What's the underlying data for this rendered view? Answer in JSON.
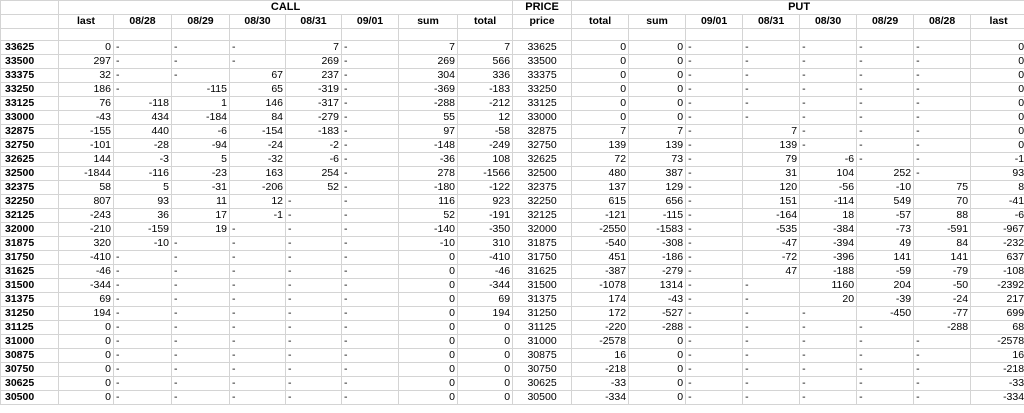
{
  "sections": {
    "call": "CALL",
    "price": "PRICE",
    "put": "PUT"
  },
  "call_headers": [
    "last",
    "08/28",
    "08/29",
    "08/30",
    "08/31",
    "09/01",
    "sum",
    "total"
  ],
  "price_header": "price",
  "put_headers": [
    "total",
    "sum",
    "09/01",
    "08/31",
    "08/30",
    "08/29",
    "08/28",
    "last"
  ],
  "rows": [
    {
      "strike": "33625",
      "call": [
        "0",
        "-",
        "-",
        "-",
        "7",
        "-",
        "7",
        "7"
      ],
      "price": "33625",
      "put": [
        "0",
        "0",
        "-",
        "-",
        "-",
        "-",
        "-",
        "0"
      ]
    },
    {
      "strike": "33500",
      "call": [
        "297",
        "-",
        "-",
        "-",
        "269",
        "-",
        "269",
        "566"
      ],
      "price": "33500",
      "put": [
        "0",
        "0",
        "-",
        "-",
        "-",
        "-",
        "-",
        "0"
      ]
    },
    {
      "strike": "33375",
      "call": [
        "32",
        "-",
        "-",
        "67",
        "237",
        "-",
        "304",
        "336"
      ],
      "price": "33375",
      "put": [
        "0",
        "0",
        "-",
        "-",
        "-",
        "-",
        "-",
        "0"
      ]
    },
    {
      "strike": "33250",
      "call": [
        "186",
        "-",
        "-115",
        "65",
        "-319",
        "-",
        "-369",
        "-183"
      ],
      "price": "33250",
      "put": [
        "0",
        "0",
        "-",
        "-",
        "-",
        "-",
        "-",
        "0"
      ]
    },
    {
      "strike": "33125",
      "call": [
        "76",
        "-118",
        "1",
        "146",
        "-317",
        "-",
        "-288",
        "-212"
      ],
      "price": "33125",
      "put": [
        "0",
        "0",
        "-",
        "-",
        "-",
        "-",
        "-",
        "0"
      ]
    },
    {
      "strike": "33000",
      "call": [
        "-43",
        "434",
        "-184",
        "84",
        "-279",
        "-",
        "55",
        "12"
      ],
      "price": "33000",
      "put": [
        "0",
        "0",
        "-",
        "-",
        "-",
        "-",
        "-",
        "0"
      ]
    },
    {
      "strike": "32875",
      "call": [
        "-155",
        "440",
        "-6",
        "-154",
        "-183",
        "-",
        "97",
        "-58"
      ],
      "price": "32875",
      "put": [
        "7",
        "7",
        "-",
        "7",
        "-",
        "-",
        "-",
        "0"
      ]
    },
    {
      "strike": "32750",
      "call": [
        "-101",
        "-28",
        "-94",
        "-24",
        "-2",
        "-",
        "-148",
        "-249"
      ],
      "price": "32750",
      "put": [
        "139",
        "139",
        "-",
        "139",
        "-",
        "-",
        "-",
        "0"
      ]
    },
    {
      "strike": "32625",
      "call": [
        "144",
        "-3",
        "5",
        "-32",
        "-6",
        "-",
        "-36",
        "108"
      ],
      "price": "32625",
      "put": [
        "72",
        "73",
        "-",
        "79",
        "-6",
        "-",
        "-",
        "-1"
      ]
    },
    {
      "strike": "32500",
      "call": [
        "-1844",
        "-116",
        "-23",
        "163",
        "254",
        "-",
        "278",
        "-1566"
      ],
      "price": "32500",
      "put": [
        "480",
        "387",
        "-",
        "31",
        "104",
        "252",
        "-",
        "93"
      ]
    },
    {
      "strike": "32375",
      "call": [
        "58",
        "5",
        "-31",
        "-206",
        "52",
        "-",
        "-180",
        "-122"
      ],
      "price": "32375",
      "put": [
        "137",
        "129",
        "-",
        "120",
        "-56",
        "-10",
        "75",
        "8"
      ]
    },
    {
      "strike": "32250",
      "call": [
        "807",
        "93",
        "11",
        "12",
        "-",
        "-",
        "116",
        "923"
      ],
      "price": "32250",
      "put": [
        "615",
        "656",
        "-",
        "151",
        "-114",
        "549",
        "70",
        "-41"
      ]
    },
    {
      "strike": "32125",
      "call": [
        "-243",
        "36",
        "17",
        "-1",
        "-",
        "-",
        "52",
        "-191"
      ],
      "price": "32125",
      "put": [
        "-121",
        "-115",
        "-",
        "-164",
        "18",
        "-57",
        "88",
        "-6"
      ]
    },
    {
      "strike": "32000",
      "call": [
        "-210",
        "-159",
        "19",
        "-",
        "-",
        "-",
        "-140",
        "-350"
      ],
      "price": "32000",
      "put": [
        "-2550",
        "-1583",
        "-",
        "-535",
        "-384",
        "-73",
        "-591",
        "-967"
      ]
    },
    {
      "strike": "31875",
      "call": [
        "320",
        "-10",
        "-",
        "-",
        "-",
        "-",
        "-10",
        "310"
      ],
      "price": "31875",
      "put": [
        "-540",
        "-308",
        "-",
        "-47",
        "-394",
        "49",
        "84",
        "-232"
      ]
    },
    {
      "strike": "31750",
      "call": [
        "-410",
        "-",
        "-",
        "-",
        "-",
        "-",
        "0",
        "-410"
      ],
      "price": "31750",
      "put": [
        "451",
        "-186",
        "-",
        "-72",
        "-396",
        "141",
        "141",
        "637"
      ]
    },
    {
      "strike": "31625",
      "call": [
        "-46",
        "-",
        "-",
        "-",
        "-",
        "-",
        "0",
        "-46"
      ],
      "price": "31625",
      "put": [
        "-387",
        "-279",
        "-",
        "47",
        "-188",
        "-59",
        "-79",
        "-108"
      ]
    },
    {
      "strike": "31500",
      "call": [
        "-344",
        "-",
        "-",
        "-",
        "-",
        "-",
        "0",
        "-344"
      ],
      "price": "31500",
      "put": [
        "-1078",
        "1314",
        "-",
        "-",
        "1160",
        "204",
        "-50",
        "-2392"
      ]
    },
    {
      "strike": "31375",
      "call": [
        "69",
        "-",
        "-",
        "-",
        "-",
        "-",
        "0",
        "69"
      ],
      "price": "31375",
      "put": [
        "174",
        "-43",
        "-",
        "-",
        "20",
        "-39",
        "-24",
        "217"
      ]
    },
    {
      "strike": "31250",
      "call": [
        "194",
        "-",
        "-",
        "-",
        "-",
        "-",
        "0",
        "194"
      ],
      "price": "31250",
      "put": [
        "172",
        "-527",
        "-",
        "-",
        "-",
        "-450",
        "-77",
        "699"
      ]
    },
    {
      "strike": "31125",
      "call": [
        "0",
        "-",
        "-",
        "-",
        "-",
        "-",
        "0",
        "0"
      ],
      "price": "31125",
      "put": [
        "-220",
        "-288",
        "-",
        "-",
        "-",
        "-",
        "-288",
        "68"
      ]
    },
    {
      "strike": "31000",
      "call": [
        "0",
        "-",
        "-",
        "-",
        "-",
        "-",
        "0",
        "0"
      ],
      "price": "31000",
      "put": [
        "-2578",
        "0",
        "-",
        "-",
        "-",
        "-",
        "-",
        "-2578"
      ]
    },
    {
      "strike": "30875",
      "call": [
        "0",
        "-",
        "-",
        "-",
        "-",
        "-",
        "0",
        "0"
      ],
      "price": "30875",
      "put": [
        "16",
        "0",
        "-",
        "-",
        "-",
        "-",
        "-",
        "16"
      ]
    },
    {
      "strike": "30750",
      "call": [
        "0",
        "-",
        "-",
        "-",
        "-",
        "-",
        "0",
        "0"
      ],
      "price": "30750",
      "put": [
        "-218",
        "0",
        "-",
        "-",
        "-",
        "-",
        "-",
        "-218"
      ]
    },
    {
      "strike": "30625",
      "call": [
        "0",
        "-",
        "-",
        "-",
        "-",
        "-",
        "0",
        "0"
      ],
      "price": "30625",
      "put": [
        "-33",
        "0",
        "-",
        "-",
        "-",
        "-",
        "-",
        "-33"
      ]
    },
    {
      "strike": "30500",
      "call": [
        "0",
        "-",
        "-",
        "-",
        "-",
        "-",
        "0",
        "0"
      ],
      "price": "30500",
      "put": [
        "-334",
        "0",
        "-",
        "-",
        "-",
        "-",
        "-",
        "-334"
      ]
    }
  ]
}
